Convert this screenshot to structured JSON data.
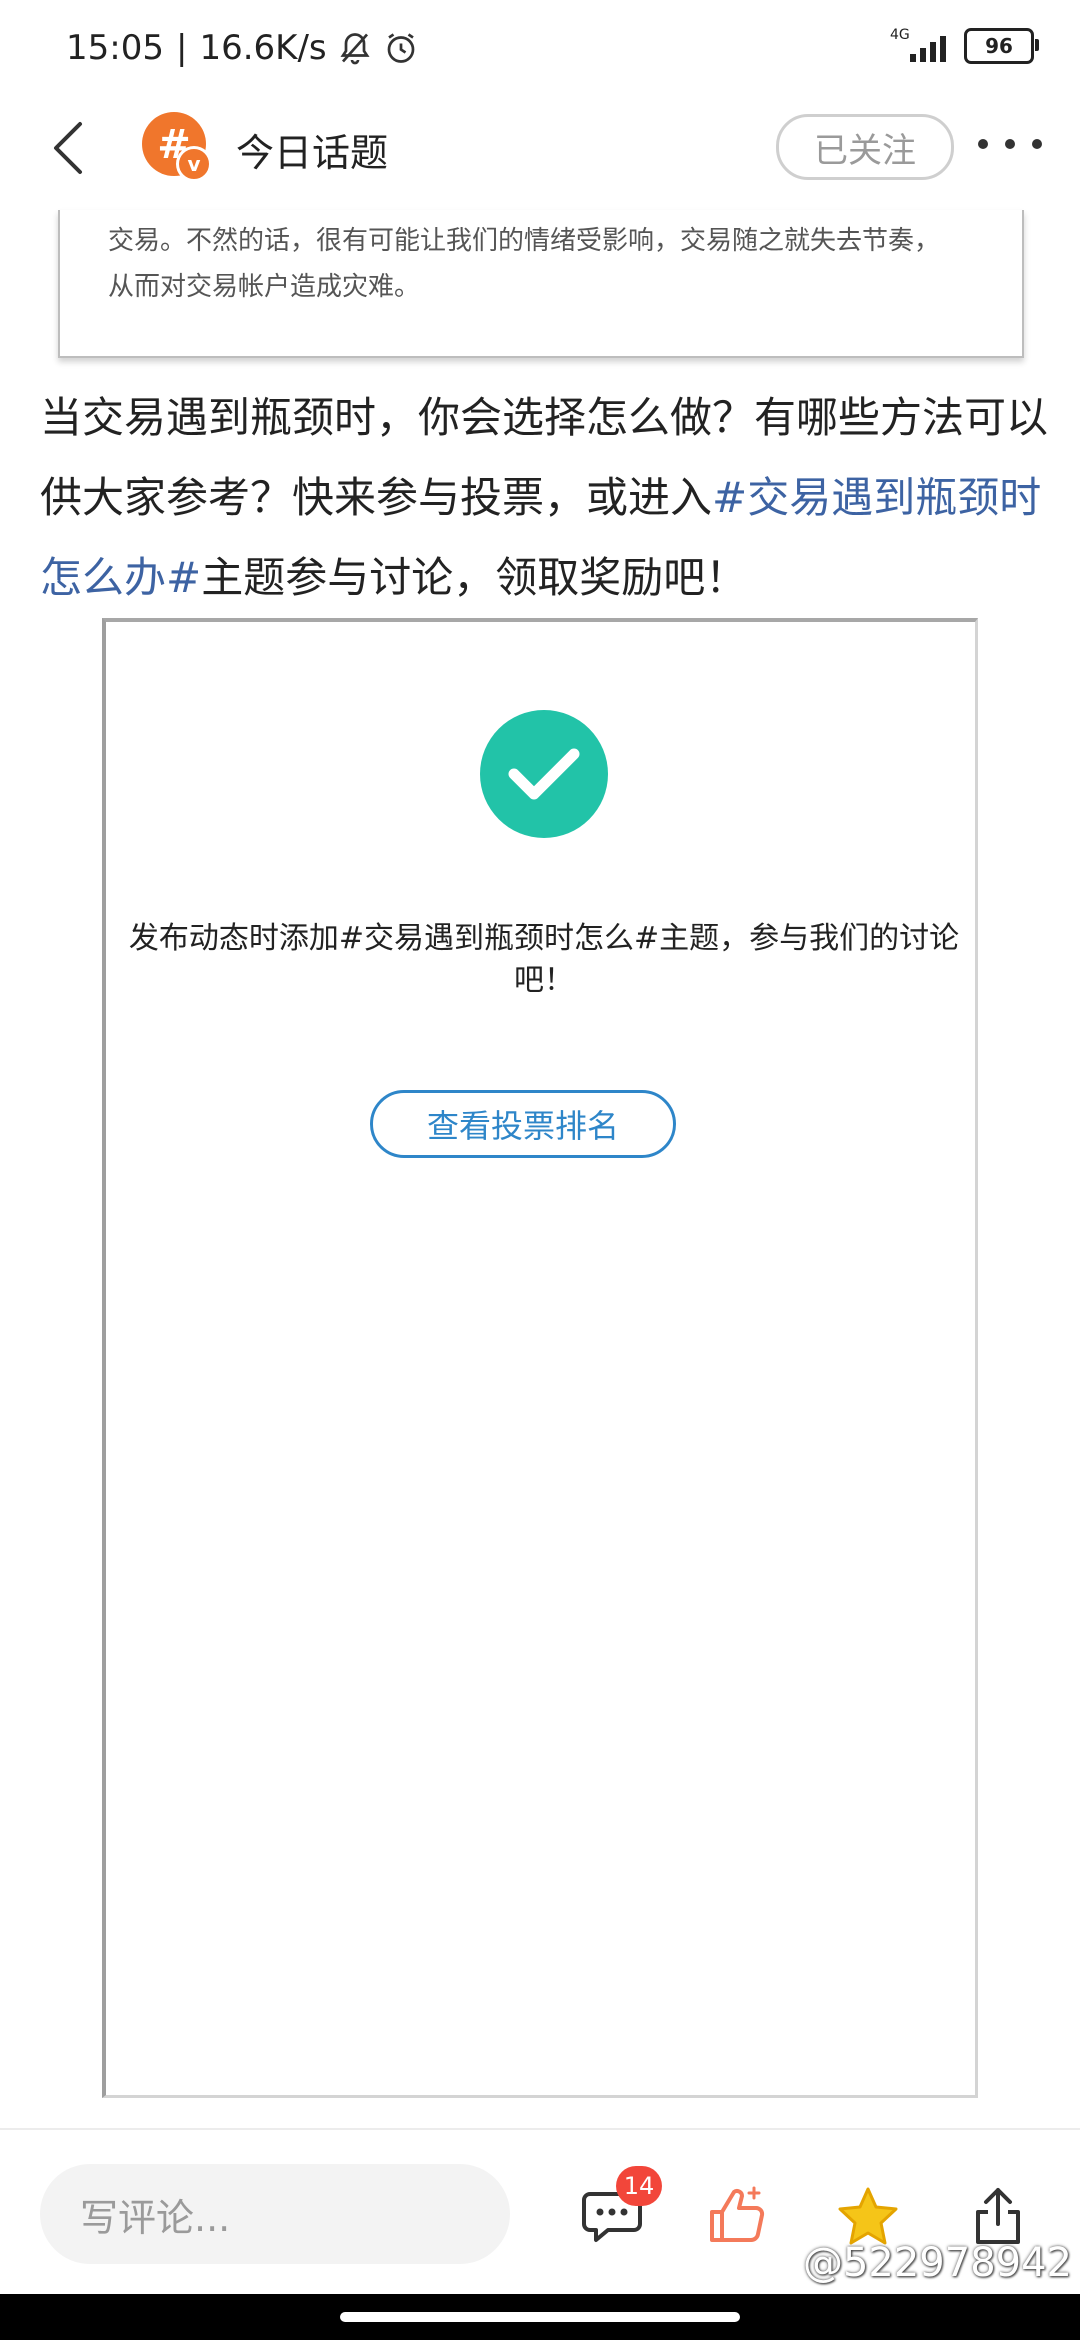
{
  "status_bar": {
    "time": "15:05",
    "separator": "|",
    "net_speed": "16.6K/s",
    "network_type": "4G",
    "battery": "96"
  },
  "header": {
    "avatar_text": "#",
    "avatar_badge": "v",
    "title": "今日话题",
    "follow_label": "已关注"
  },
  "quote": {
    "line1": "交易。不然的话，很有可能让我们的情绪受影响，交易随之就失去节奏，",
    "line2": "从而对交易帐户造成灾难。"
  },
  "paragraph": {
    "before": "当交易遇到瓶颈时，你会选择怎么做？有哪些方法可以供大家参考？快来参与投票，或进入",
    "tag": "#交易遇到瓶颈时怎么办#",
    "after": "主题参与讨论，领取奖励吧！"
  },
  "vote": {
    "message": "发布动态时添加#交易遇到瓶颈时怎么#主题，参与我们的讨论吧！",
    "rank_button": "查看投票排名"
  },
  "bottom_bar": {
    "comment_placeholder": "写评论...",
    "comment_count": "14"
  },
  "watermark": "@522978942",
  "colors": {
    "accent_link": "#3d63a3",
    "check": "#22c3a8",
    "rank_button": "#2e86c9",
    "badge": "#f2463a",
    "like": "#f47a5a",
    "star": "#f5c518"
  }
}
